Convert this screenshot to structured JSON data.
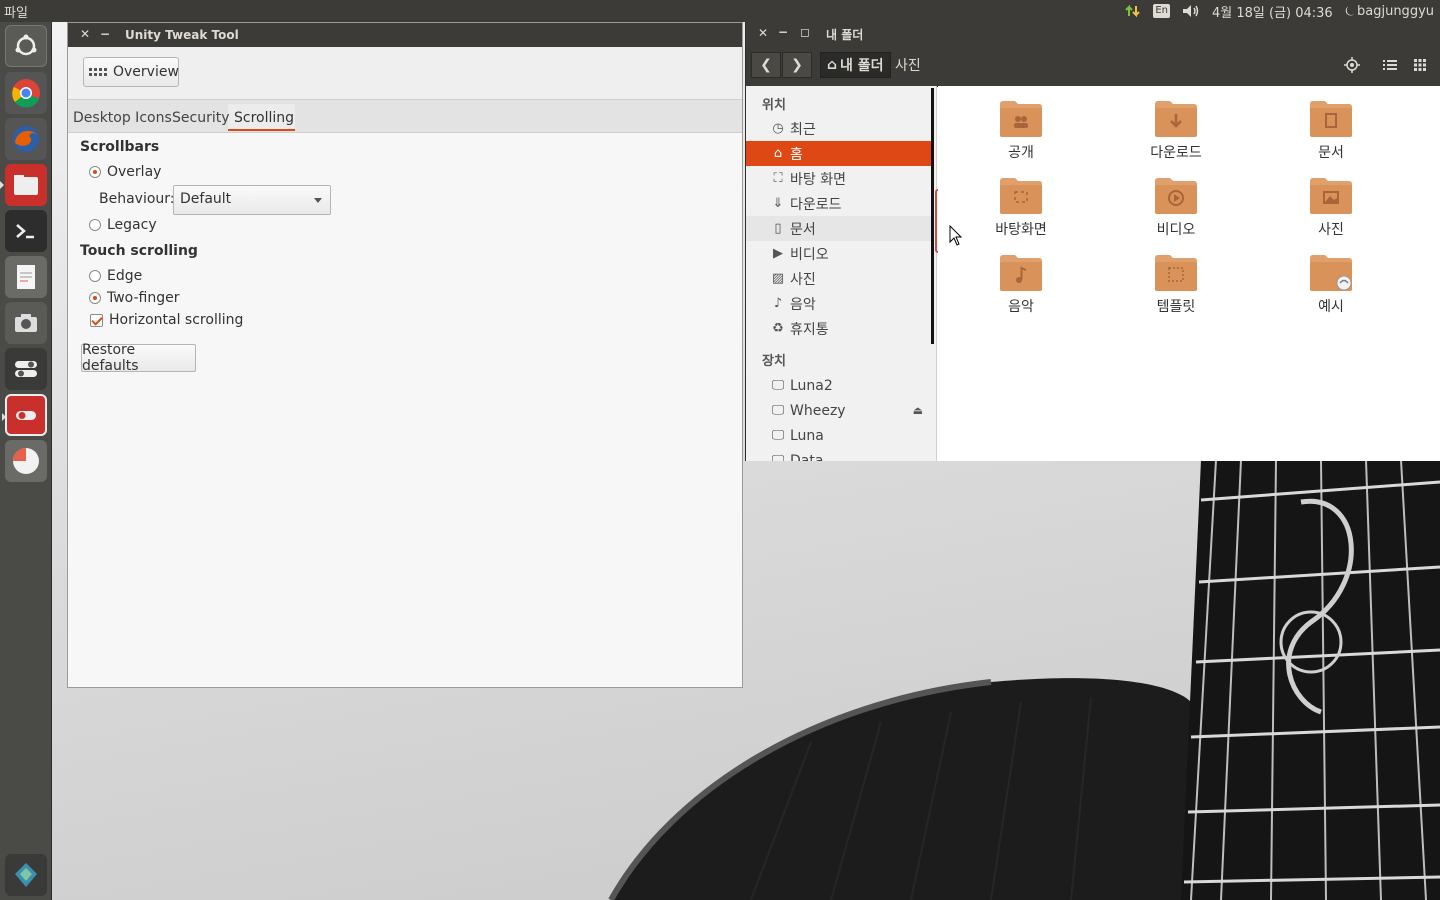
{
  "top_panel": {
    "menu": "파일",
    "keyboard": "En",
    "clock": "4월 18일 (금) 04:36",
    "user": "bagjunggyu"
  },
  "launcher": {
    "items": [
      {
        "name": "dash-icon"
      },
      {
        "name": "chrome-icon"
      },
      {
        "name": "firefox-icon"
      },
      {
        "name": "files-icon"
      },
      {
        "name": "terminal-icon"
      },
      {
        "name": "text-editor-icon"
      },
      {
        "name": "camera-icon"
      },
      {
        "name": "settings-toggle-icon"
      },
      {
        "name": "tweak-tool-icon"
      },
      {
        "name": "pie-app-icon"
      },
      {
        "name": "trash-icon"
      }
    ]
  },
  "tweak": {
    "title": "Unity Tweak Tool",
    "overview_label": "Overview",
    "tabs": [
      "Desktop Icons",
      "Security",
      "Scrolling"
    ],
    "scrollbars_heading": "Scrollbars",
    "overlay_label": "Overlay",
    "behaviour_label": "Behaviour:",
    "behaviour_value": "Default",
    "legacy_label": "Legacy",
    "touch_heading": "Touch scrolling",
    "edge_label": "Edge",
    "twofinger_label": "Two-finger",
    "horizontal_label": "Horizontal scrolling",
    "restore_label": "Restore defaults"
  },
  "files": {
    "title": "내 폴더",
    "crumbs": [
      "내 폴더",
      "사진"
    ],
    "places_heading": "위치",
    "places": [
      {
        "label": "최근",
        "icon": "clock-icon"
      },
      {
        "label": "홈",
        "icon": "home-icon"
      },
      {
        "label": "바탕 화면",
        "icon": "desktop-icon"
      },
      {
        "label": "다운로드",
        "icon": "download-icon"
      },
      {
        "label": "문서",
        "icon": "document-icon"
      },
      {
        "label": "비디오",
        "icon": "video-icon"
      },
      {
        "label": "사진",
        "icon": "picture-icon"
      },
      {
        "label": "음악",
        "icon": "music-icon"
      },
      {
        "label": "휴지통",
        "icon": "trash-icon"
      }
    ],
    "devices_heading": "장치",
    "devices": [
      {
        "label": "Luna2"
      },
      {
        "label": "Wheezy"
      },
      {
        "label": "Luna"
      },
      {
        "label": "Data"
      }
    ],
    "folders": [
      {
        "label": "공개",
        "icon": "public-icon"
      },
      {
        "label": "다운로드",
        "icon": "download-icon"
      },
      {
        "label": "문서",
        "icon": "document-icon"
      },
      {
        "label": "바탕화면",
        "icon": "desktop-icon"
      },
      {
        "label": "비디오",
        "icon": "video-icon"
      },
      {
        "label": "사진",
        "icon": "picture-icon"
      },
      {
        "label": "음악",
        "icon": "music-icon"
      },
      {
        "label": "템플릿",
        "icon": "template-icon"
      },
      {
        "label": "예시",
        "icon": "examples-icon"
      }
    ]
  },
  "colors": {
    "accent": "#dd4814",
    "panel": "#3c3b37",
    "folder": "#e0a06c"
  }
}
